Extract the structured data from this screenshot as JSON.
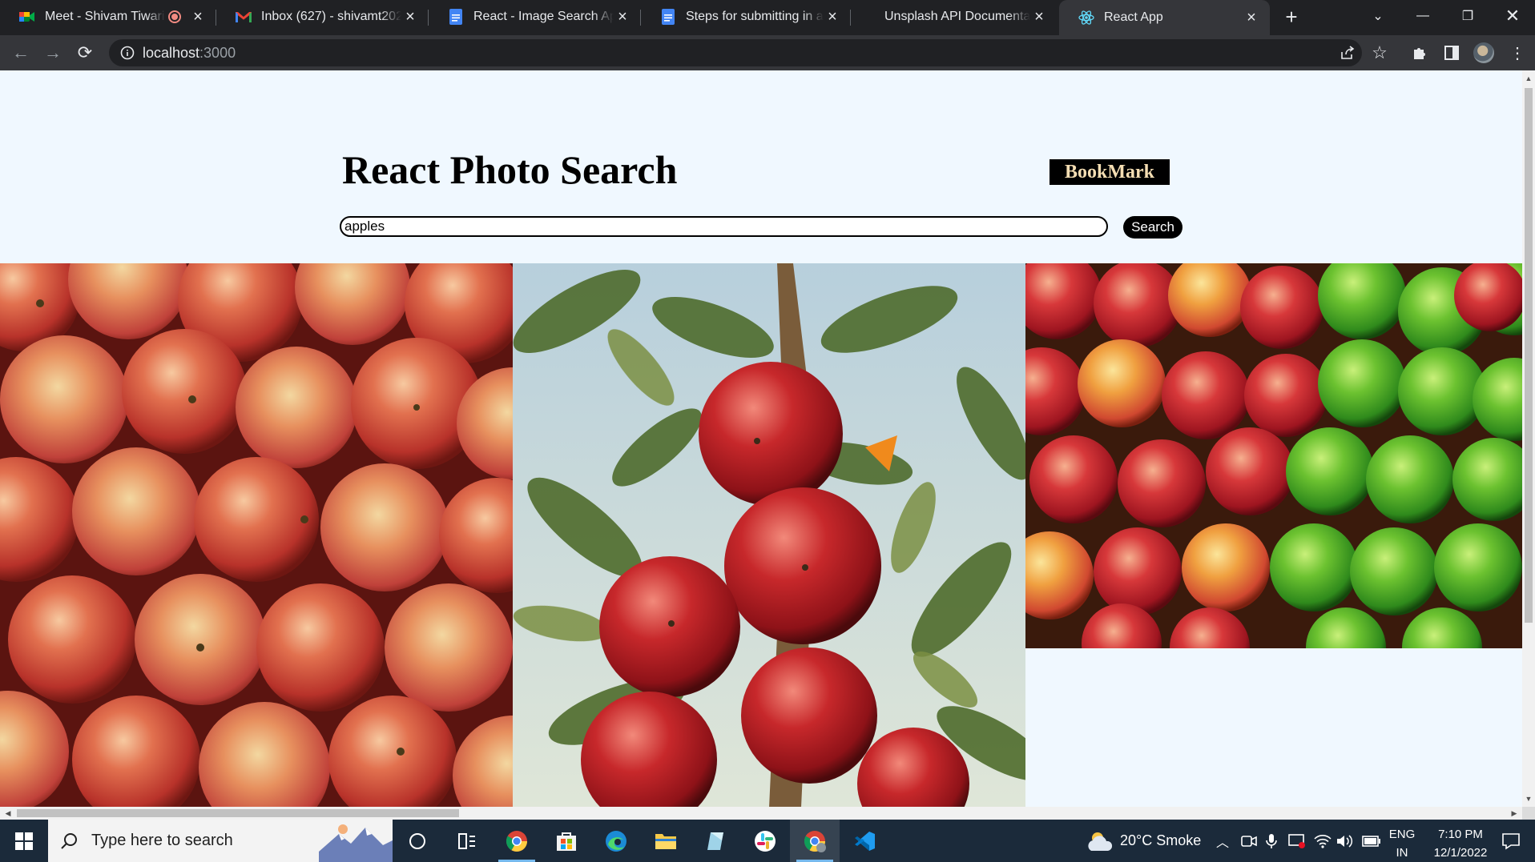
{
  "browser": {
    "tabs": [
      {
        "title": "Meet - Shivam Tiwari| F",
        "favicon": "google-meet-icon",
        "recording": true
      },
      {
        "title": "Inbox (627) - shivamt2023@",
        "favicon": "gmail-icon"
      },
      {
        "title": "React - Image Search App -",
        "favicon": "google-docs-icon"
      },
      {
        "title": "Steps for submitting in a Fe",
        "favicon": "google-docs-icon"
      },
      {
        "title": "Unsplash API Documentatio",
        "favicon": "unsplash-icon"
      },
      {
        "title": "React App",
        "favicon": "react-icon",
        "active": true
      }
    ],
    "url_host": "localhost",
    "url_port": ":3000"
  },
  "page": {
    "title": "React Photo Search",
    "bookmark_label": "BookMark",
    "search_value": "apples",
    "search_label": "Search",
    "photos": [
      {
        "name": "pile-of-red-apples"
      },
      {
        "name": "apples-on-tree"
      },
      {
        "name": "red-and-green-apples"
      }
    ]
  },
  "taskbar": {
    "search_placeholder": "Type here to search",
    "weather": "20°C  Smoke",
    "lang_line1": "ENG",
    "lang_line2": "IN",
    "time": "7:10 PM",
    "date": "12/1/2022"
  }
}
